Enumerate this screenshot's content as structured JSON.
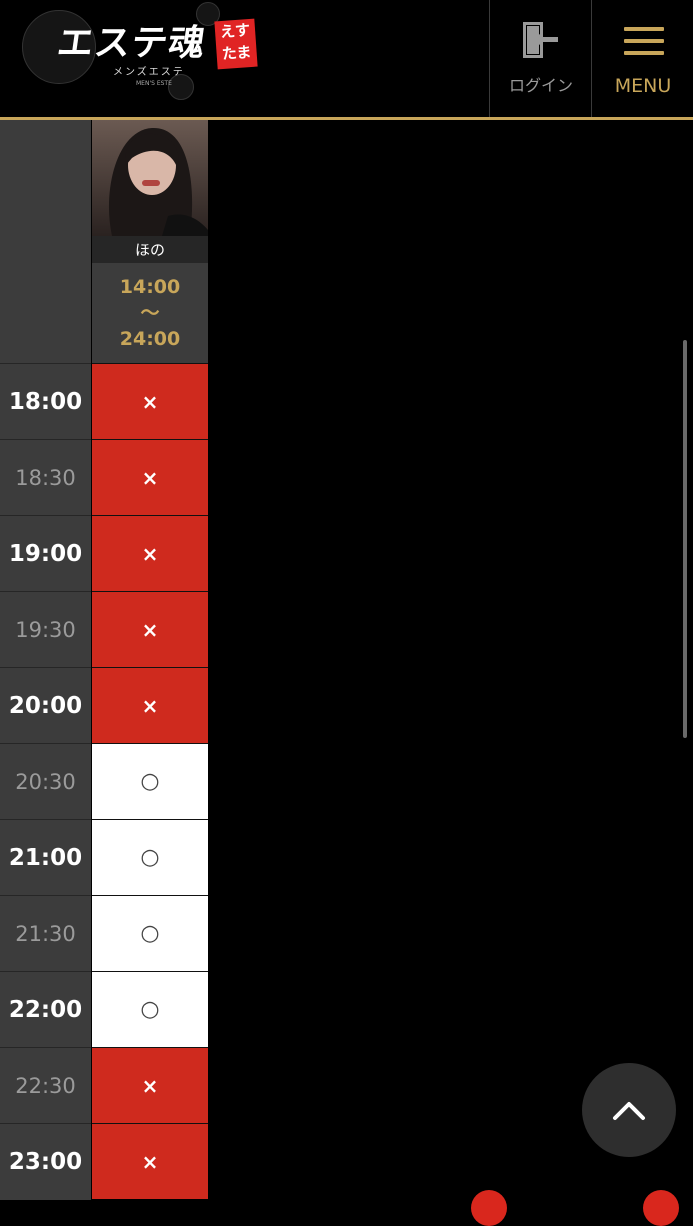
{
  "header": {
    "logo": {
      "main_text": "エステ魂",
      "badge_text": "えすたま",
      "subtitle": "メンズエステ",
      "subtitle_small": "MEN'S ESTE"
    },
    "login_label": "ログイン",
    "menu_label": "MENU",
    "accent_color": "#c8a65a"
  },
  "cast": {
    "name": "ほの",
    "shift_start": "14:00",
    "shift_separator": "〜",
    "shift_end": "24:00"
  },
  "schedule": {
    "legend_colors": {
      "closed": "#cf2a1e",
      "open": "#ffffff"
    },
    "slots": [
      {
        "time": "18:00",
        "status": "×"
      },
      {
        "time": "18:30",
        "status": "×"
      },
      {
        "time": "19:00",
        "status": "×"
      },
      {
        "time": "19:30",
        "status": "×"
      },
      {
        "time": "20:00",
        "status": "×"
      },
      {
        "time": "20:30",
        "status": "○"
      },
      {
        "time": "21:00",
        "status": "○"
      },
      {
        "time": "21:30",
        "status": "○"
      },
      {
        "time": "22:00",
        "status": "○"
      },
      {
        "time": "22:30",
        "status": "×"
      },
      {
        "time": "23:00",
        "status": "×"
      }
    ]
  },
  "icons": {
    "login": "login-door-icon",
    "menu": "hamburger-icon",
    "back_to_top": "chevron-up-icon"
  }
}
